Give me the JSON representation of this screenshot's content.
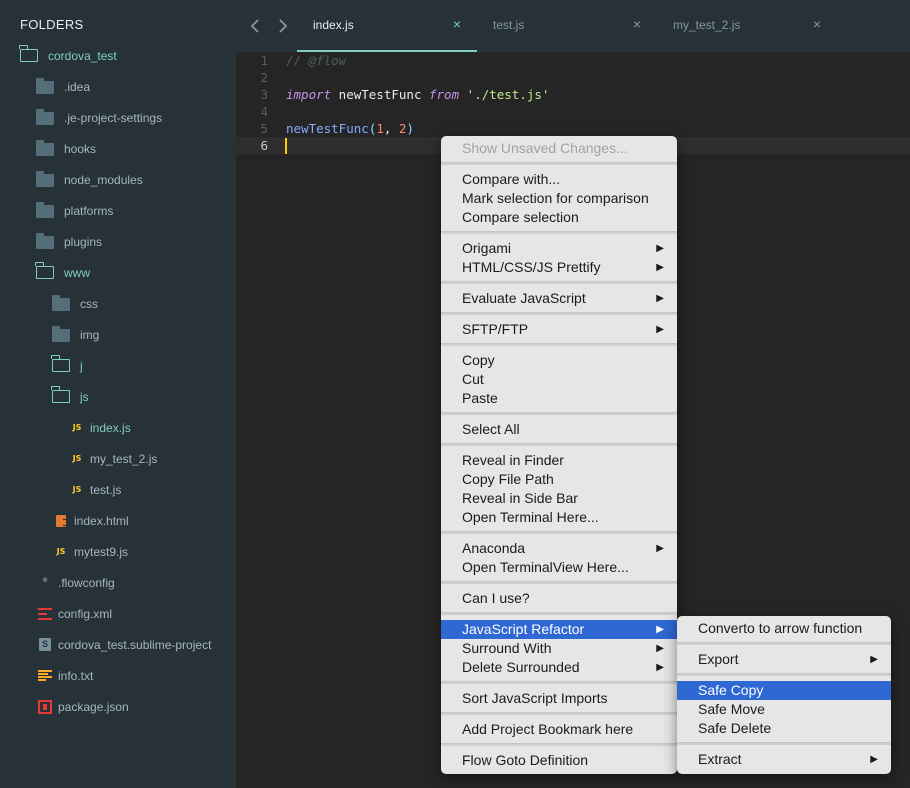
{
  "sidebar": {
    "header": "FOLDERS",
    "items": [
      {
        "label": "cordova_test",
        "icon": "folder-open-icon",
        "depth": 0
      },
      {
        "label": ".idea",
        "icon": "folder-icon",
        "depth": 1
      },
      {
        "label": ".je-project-settings",
        "icon": "folder-icon",
        "depth": 1
      },
      {
        "label": "hooks",
        "icon": "folder-icon",
        "depth": 1
      },
      {
        "label": "node_modules",
        "icon": "folder-icon",
        "depth": 1
      },
      {
        "label": "platforms",
        "icon": "folder-icon",
        "depth": 1
      },
      {
        "label": "plugins",
        "icon": "folder-icon",
        "depth": 1
      },
      {
        "label": "www",
        "icon": "folder-open-icon",
        "depth": 1
      },
      {
        "label": "css",
        "icon": "folder-icon",
        "depth": 2
      },
      {
        "label": "img",
        "icon": "folder-icon",
        "depth": 2
      },
      {
        "label": "j",
        "icon": "folder-open-icon",
        "depth": 2
      },
      {
        "label": "js",
        "icon": "folder-open-icon",
        "depth": 2
      },
      {
        "label": "index.js",
        "icon": "js-file-icon",
        "badge": "JS",
        "depth": 3
      },
      {
        "label": "my_test_2.js",
        "icon": "js-file-icon",
        "badge": "JS",
        "depth": 3
      },
      {
        "label": "test.js",
        "icon": "js-file-icon",
        "badge": "JS",
        "depth": 3
      },
      {
        "label": "index.html",
        "icon": "html-file-icon",
        "depth": 2
      },
      {
        "label": "mytest9.js",
        "icon": "js-file-icon",
        "badge": "JS",
        "depth": 1
      },
      {
        "label": ".flowconfig",
        "icon": "asterisk-file-icon",
        "badge": "*",
        "depth": 0
      },
      {
        "label": "config.xml",
        "icon": "xml-file-icon",
        "depth": 0
      },
      {
        "label": "cordova_test.sublime-project",
        "icon": "sublime-project-icon",
        "badge": "S",
        "depth": 0
      },
      {
        "label": "info.txt",
        "icon": "text-file-icon",
        "depth": 0
      },
      {
        "label": "package.json",
        "icon": "package-json-icon",
        "depth": 0
      }
    ]
  },
  "tabs": {
    "back_icon": "chevron-left-icon",
    "forward_icon": "chevron-right-icon",
    "close_glyph": "×",
    "items": [
      {
        "label": "index.js",
        "active": true
      },
      {
        "label": "test.js",
        "active": false
      },
      {
        "label": "my_test_2.js",
        "active": false
      }
    ]
  },
  "editor": {
    "lines": [
      {
        "n": "1",
        "comment": "// @flow"
      },
      {
        "n": "2"
      },
      {
        "n": "3",
        "kw1": "import",
        "ident": " newTestFunc ",
        "kw2": "from",
        "sp": " ",
        "str": "'./test.js'"
      },
      {
        "n": "4"
      },
      {
        "n": "5",
        "fn": "newTestFunc",
        "p1": "(",
        "a": "1",
        "comma": ", ",
        "b": "2",
        "p2": ")"
      },
      {
        "n": "6"
      }
    ],
    "current_line": "6"
  },
  "context_menu": {
    "submenu_arrow": "▶",
    "items": [
      "Show Unsaved Changes...",
      "Compare with...",
      "Mark selection for comparison",
      "Compare selection",
      "Origami",
      "HTML/CSS/JS Prettify",
      "Evaluate JavaScript",
      "SFTP/FTP",
      "Copy",
      "Cut",
      "Paste",
      "Select All",
      "Reveal in Finder",
      "Copy File Path",
      "Reveal in Side Bar",
      "Open Terminal Here...",
      "Anaconda",
      "Open TerminalView Here...",
      "Can I use?",
      "JavaScript Refactor",
      "Surround With",
      "Delete Surrounded",
      "Sort JavaScript Imports",
      "Add Project Bookmark here",
      "Flow Goto Definition"
    ]
  },
  "submenu": {
    "items": [
      "Converto to arrow function",
      "Export",
      "Safe Copy",
      "Safe Move",
      "Safe Delete",
      "Extract"
    ]
  },
  "colors": {
    "sidebar_bg": "#263238",
    "editor_bg": "#252525",
    "accent": "#80cbc4",
    "menu_bg": "#e6e6e6",
    "menu_highlight": "#2f67d3"
  }
}
